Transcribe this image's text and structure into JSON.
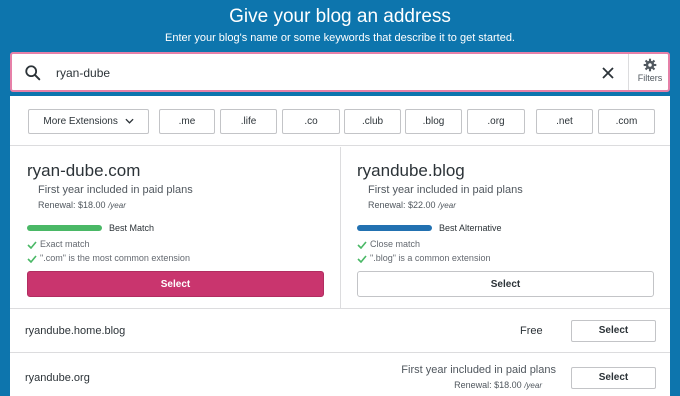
{
  "header": {
    "title": "Give your blog an address",
    "subtitle": "Enter your blog's name or some keywords that describe it to get started."
  },
  "search": {
    "value": "ryan-dube",
    "filters_label": "Filters"
  },
  "extensions": {
    "more_label": "More Extensions",
    "items": [
      ".me",
      ".life",
      ".co",
      ".club",
      ".blog",
      ".org",
      ".net",
      ".com"
    ]
  },
  "cards": [
    {
      "domain": "ryan-dube.com",
      "included": "First year included in paid plans",
      "renewal": "Renewal: $18.00",
      "per": "/year",
      "match_label": "Best Match",
      "bar_color": "#4ab866",
      "features": [
        "Exact match",
        "\".com\" is the most common extension"
      ],
      "select_label": "Select"
    },
    {
      "domain": "ryandube.blog",
      "included": "First year included in paid plans",
      "renewal": "Renewal: $22.00",
      "per": "/year",
      "match_label": "Best Alternative",
      "bar_color": "#2271b1",
      "features": [
        "Close match",
        "\".blog\" is a common extension"
      ],
      "select_label": "Select"
    }
  ],
  "rows": [
    {
      "domain": "ryandube.home.blog",
      "price": "Free",
      "select_label": "Select"
    },
    {
      "domain": "ryandube.org",
      "included": "First year included in paid plans",
      "renewal": "Renewal: $18.00",
      "per": "/year",
      "select_label": "Select"
    }
  ],
  "colors": {
    "background": "#0d75ad",
    "accent": "#c9356e",
    "success": "#4ab866",
    "focus_border": "#e680a8"
  }
}
